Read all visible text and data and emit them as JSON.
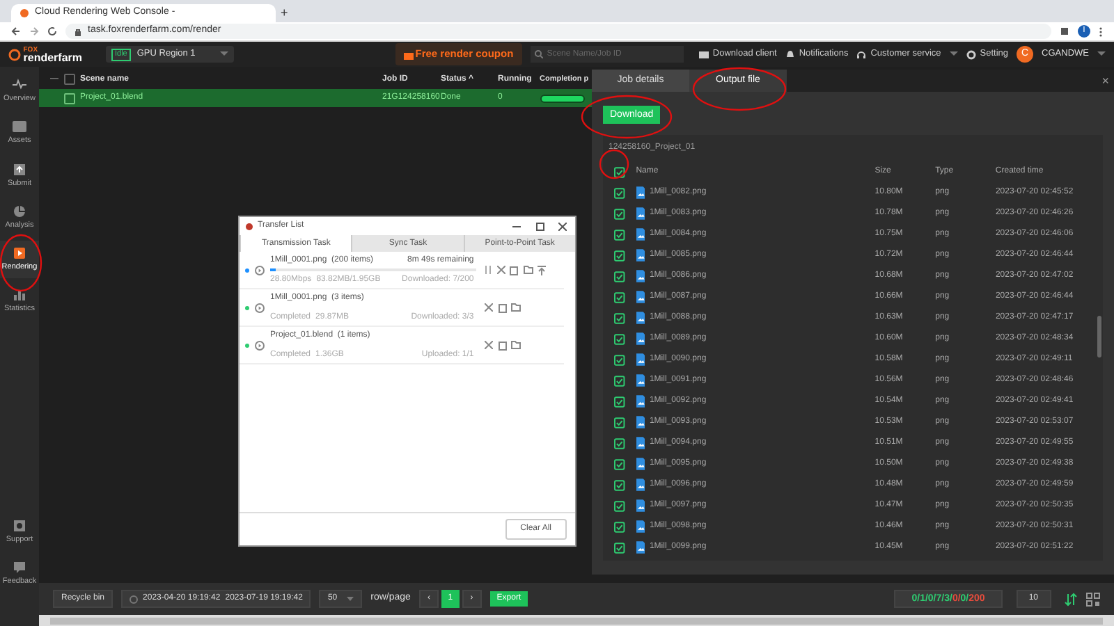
{
  "browser": {
    "tab_title": "Cloud Rendering Web Console - ",
    "url": "task.foxrenderfarm.com/render",
    "profile": "I",
    "new_tab": "+"
  },
  "header": {
    "logo_top": "FOX",
    "logo_bottom": "renderfarm",
    "region_status": "Idle",
    "region": "GPU Region 1",
    "coupon": "Free render coupon",
    "search": {
      "placeholder": "Scene Name/Job ID"
    },
    "links": [
      "Download client",
      "Notifications",
      "Customer service",
      "Setting"
    ],
    "avatar": "C",
    "user": "CGANDWE"
  },
  "sidebar": {
    "top": [
      {
        "label": "Overview",
        "selected": false
      },
      {
        "label": "Assets",
        "selected": false
      },
      {
        "label": "Submit",
        "selected": false
      },
      {
        "label": "Analysis",
        "selected": false
      },
      {
        "label": "Rendering",
        "selected": true
      },
      {
        "label": "Statistics",
        "selected": false
      }
    ],
    "bottom": [
      {
        "label": "Support",
        "selected": false
      },
      {
        "label": "Feedback",
        "selected": false
      }
    ]
  },
  "jobs": {
    "collapse": "—",
    "all_checked": false,
    "columns": [
      "Scene name",
      "Job ID",
      "Status",
      "Running",
      "Completion p"
    ],
    "sort_mark": "^",
    "rows": [
      {
        "scene": "Project_01.blend",
        "job_id": "21G124258160",
        "status": "Done",
        "running": "0",
        "level": 1,
        "selected": true
      }
    ]
  },
  "transfer": {
    "title": "Transfer List",
    "tabs": [
      {
        "label": "Transmission Task",
        "selected": true
      },
      {
        "label": "Sync Task",
        "selected": false
      },
      {
        "label": "Point-to-Point Task",
        "selected": false
      }
    ],
    "items": [
      {
        "name": "1Mill_0001.png",
        "count": "(200 items)",
        "remaining": "8m 49s remaining",
        "active": true,
        "level": 0.03,
        "speed": "28.80Mbps",
        "size": "83.82MB/1.95GB",
        "progress": "Downloaded: 7/200"
      },
      {
        "name": "1Mill_0001.png",
        "count": "(3 items)",
        "active": false,
        "speed": "Completed",
        "size": "29.87MB",
        "progress": "Downloaded: 3/3"
      },
      {
        "name": "Project_01.blend",
        "count": "(1 items)",
        "active": false,
        "speed": "Completed",
        "size": "1.36GB",
        "progress": "Uploaded: 1/1"
      }
    ],
    "clear": "Clear All"
  },
  "drawer": {
    "tabs": [
      {
        "label": "Job details",
        "selected": false
      },
      {
        "label": "Output file",
        "selected": true
      }
    ],
    "close": "×",
    "download": "Download",
    "folder": "124258160_Project_01",
    "columns": [
      "Name",
      "Size",
      "Type",
      "Created time"
    ],
    "all_checked": true,
    "files": [
      {
        "name": "1Mill_0082.png",
        "size": "10.80M",
        "type": "png",
        "time": "2023-07-20 02:45:52",
        "checked": true
      },
      {
        "name": "1Mill_0083.png",
        "size": "10.78M",
        "type": "png",
        "time": "2023-07-20 02:46:26",
        "checked": true
      },
      {
        "name": "1Mill_0084.png",
        "size": "10.75M",
        "type": "png",
        "time": "2023-07-20 02:46:06",
        "checked": true
      },
      {
        "name": "1Mill_0085.png",
        "size": "10.72M",
        "type": "png",
        "time": "2023-07-20 02:46:44",
        "checked": true
      },
      {
        "name": "1Mill_0086.png",
        "size": "10.68M",
        "type": "png",
        "time": "2023-07-20 02:47:02",
        "checked": true
      },
      {
        "name": "1Mill_0087.png",
        "size": "10.66M",
        "type": "png",
        "time": "2023-07-20 02:46:44",
        "checked": true
      },
      {
        "name": "1Mill_0088.png",
        "size": "10.63M",
        "type": "png",
        "time": "2023-07-20 02:47:17",
        "checked": true
      },
      {
        "name": "1Mill_0089.png",
        "size": "10.60M",
        "type": "png",
        "time": "2023-07-20 02:48:34",
        "checked": true
      },
      {
        "name": "1Mill_0090.png",
        "size": "10.58M",
        "type": "png",
        "time": "2023-07-20 02:49:11",
        "checked": true
      },
      {
        "name": "1Mill_0091.png",
        "size": "10.56M",
        "type": "png",
        "time": "2023-07-20 02:48:46",
        "checked": true
      },
      {
        "name": "1Mill_0092.png",
        "size": "10.54M",
        "type": "png",
        "time": "2023-07-20 02:49:41",
        "checked": true
      },
      {
        "name": "1Mill_0093.png",
        "size": "10.53M",
        "type": "png",
        "time": "2023-07-20 02:53:07",
        "checked": true
      },
      {
        "name": "1Mill_0094.png",
        "size": "10.51M",
        "type": "png",
        "time": "2023-07-20 02:49:55",
        "checked": true
      },
      {
        "name": "1Mill_0095.png",
        "size": "10.50M",
        "type": "png",
        "time": "2023-07-20 02:49:38",
        "checked": true
      },
      {
        "name": "1Mill_0096.png",
        "size": "10.48M",
        "type": "png",
        "time": "2023-07-20 02:49:59",
        "checked": true
      },
      {
        "name": "1Mill_0097.png",
        "size": "10.47M",
        "type": "png",
        "time": "2023-07-20 02:50:35",
        "checked": true
      },
      {
        "name": "1Mill_0098.png",
        "size": "10.46M",
        "type": "png",
        "time": "2023-07-20 02:50:31",
        "checked": true
      },
      {
        "name": "1Mill_0099.png",
        "size": "10.45M",
        "type": "png",
        "time": "2023-07-20 02:51:22",
        "checked": true
      }
    ]
  },
  "footer": {
    "recycle": "Recycle bin",
    "date_from": "2023-04-20 19:19:42",
    "date_to": "2023-07-19 19:19:42",
    "rows_per_page": "50",
    "rows_label": "row/page",
    "prev": "‹",
    "page": "1",
    "next": "›",
    "export": "Export",
    "counts": [
      {
        "text": "0/1/0/7/3/",
        "color": "#2ecc71"
      },
      {
        "text": "0/",
        "color": "#e74c3c"
      },
      {
        "text": "0/",
        "color": "#2ecc71"
      },
      {
        "text": "200",
        "color": "#e74c3c"
      }
    ],
    "page_size": "10"
  }
}
